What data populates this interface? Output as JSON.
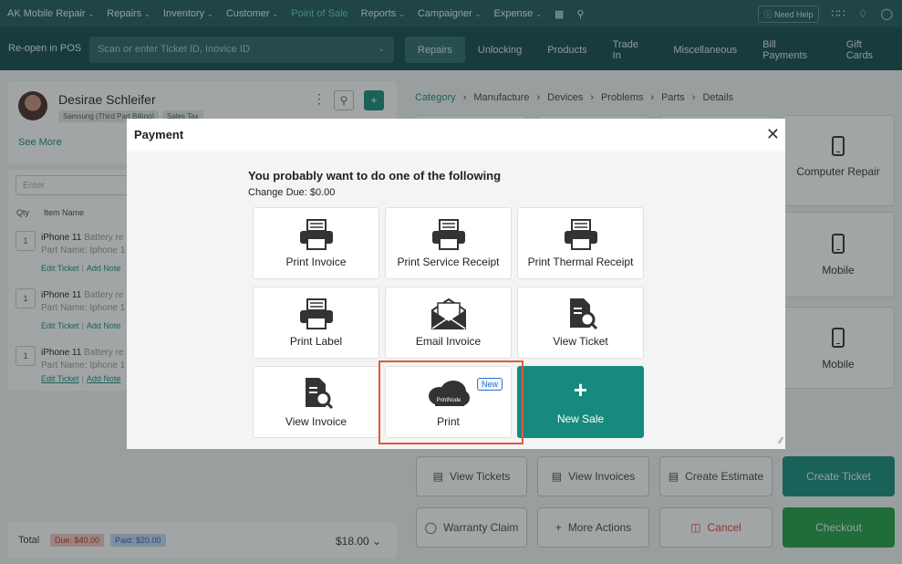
{
  "topnav": {
    "items": [
      {
        "label": "AK Mobile Repair",
        "chevron": true
      },
      {
        "label": "Repairs",
        "chevron": true
      },
      {
        "label": "Inventory",
        "chevron": true
      },
      {
        "label": "Customer",
        "chevron": true
      },
      {
        "label": "Point of Sale",
        "chevron": false,
        "active": true
      },
      {
        "label": "Reports",
        "chevron": true
      },
      {
        "label": "Campaigner",
        "chevron": true
      },
      {
        "label": "Expense",
        "chevron": true
      }
    ],
    "icons": [
      "scan-icon",
      "search-icon"
    ],
    "help_label": "Need Help",
    "right_icons": [
      "apps-grid-icon",
      "bell-icon",
      "user-icon"
    ]
  },
  "subbar": {
    "reopen_label": "Re-open in POS",
    "scan_placeholder": "Scan or enter Ticket ID, Inovice ID",
    "tabs": [
      "Repairs",
      "Unlocking",
      "Products",
      "Trade In",
      "Miscellaneous",
      "Bill Payments",
      "Gift Cards"
    ],
    "active_tab": "Repairs"
  },
  "customer": {
    "name": "Desirae Schleifer",
    "badges": [
      "Samsung (Third Part Billing)",
      "Sales Tax"
    ],
    "see_more": "See More"
  },
  "cart": {
    "enter_placeholder": "Enter",
    "col_qty": "Qty",
    "col_item": "Item Name",
    "rows": [
      {
        "qty": "1",
        "item": "iPhone 11",
        "item_suffix": "Battery re",
        "part": "Part Name: Iphone 1",
        "edit": "Edit Ticket",
        "note": "Add Note"
      },
      {
        "qty": "1",
        "item": "iPhone 11",
        "item_suffix": "Battery re",
        "part": "Part Name: Iphone 1",
        "edit": "Edit Ticket",
        "note": "Add Note"
      },
      {
        "qty": "1",
        "item": "iPhone 11",
        "item_suffix": "Battery re",
        "part": "Part Name: Iphone 1",
        "edit": "Edit Ticket",
        "note": "Add Note"
      }
    ]
  },
  "totals": {
    "label": "Total",
    "due": "Due: $40.00",
    "paid": "Paid: $20.00",
    "amount": "$18.00"
  },
  "breadcrumb": [
    "Category",
    "Manufacture",
    "Devices",
    "Problems",
    "Parts",
    "Details"
  ],
  "device_tiles": [
    "Computer Repair",
    "Mobile",
    "Mobile"
  ],
  "actions": {
    "view_tickets": "View Tickets",
    "view_invoices": "View Invoices",
    "create_estimate": "Create Estimate",
    "create_ticket": "Create Ticket",
    "warranty_claim": "Warranty Claim",
    "more_actions": "More Actions",
    "cancel": "Cancel",
    "checkout": "Checkout"
  },
  "modal": {
    "title": "Payment",
    "prompt": "You probably want to do one of the following",
    "change_due": "Change Due: $0.00",
    "options": [
      {
        "label": "Print Invoice",
        "icon": "printer-icon"
      },
      {
        "label": "Print Service Receipt",
        "icon": "printer-icon"
      },
      {
        "label": "Print Thermal Receipt",
        "icon": "printer-icon"
      },
      {
        "label": "Print Label",
        "icon": "printer-icon"
      },
      {
        "label": "Email Invoice",
        "icon": "envelope-icon"
      },
      {
        "label": "View Ticket",
        "icon": "document-search-icon"
      },
      {
        "label": "View Invoice",
        "icon": "document-search-icon"
      },
      {
        "label": "Print",
        "icon": "printnode-cloud-icon",
        "badge": "New",
        "cloud_text": "PrintNode"
      },
      {
        "label": "New Sale",
        "icon": "plus-icon",
        "symbol": "+"
      }
    ]
  }
}
